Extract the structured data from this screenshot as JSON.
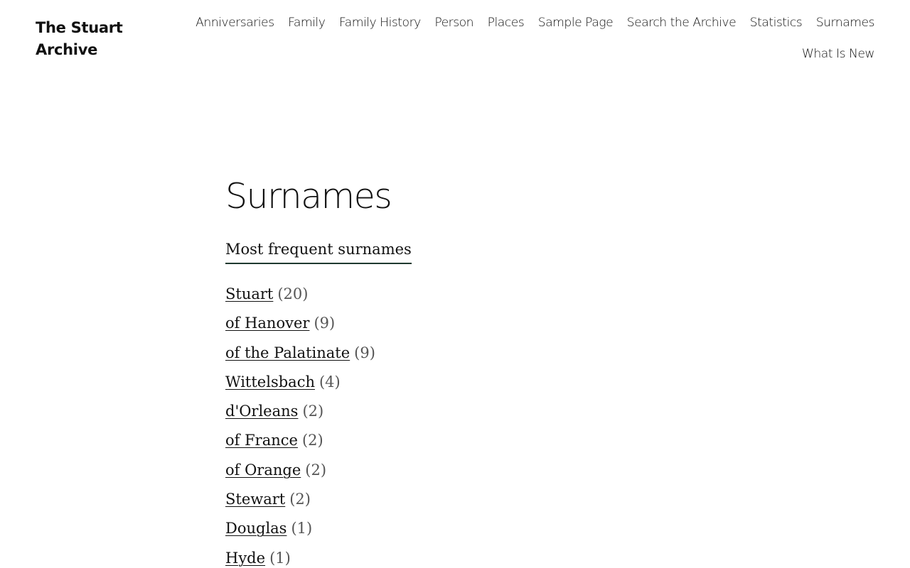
{
  "site": {
    "title": "The Stuart Archive"
  },
  "nav": {
    "row1": [
      "Anniversaries",
      "Family",
      "Family History",
      "Person",
      "Places",
      "Sample Page",
      "Search the Archive",
      "Statistics",
      "Surnames"
    ],
    "row2": [
      "What Is New"
    ]
  },
  "main": {
    "title": "Surnames",
    "block_heading": "Most frequent surnames",
    "surnames": [
      {
        "name": "Stuart",
        "count": "(20)"
      },
      {
        "name": "of Hanover",
        "count": "(9)"
      },
      {
        "name": "of the Palatinate",
        "count": "(9)"
      },
      {
        "name": "Wittelsbach",
        "count": "(4)"
      },
      {
        "name": "d'Orleans",
        "count": "(2)"
      },
      {
        "name": "of France",
        "count": "(2)"
      },
      {
        "name": "of Orange",
        "count": "(2)"
      },
      {
        "name": "Stewart",
        "count": "(2)"
      },
      {
        "name": "Douglas",
        "count": "(1)"
      },
      {
        "name": "Hyde",
        "count": "(1)"
      }
    ]
  },
  "colors": {
    "text": "#111111",
    "muted": "#555555",
    "accent_underline": "#1f3a30",
    "background": "#ffffff"
  }
}
